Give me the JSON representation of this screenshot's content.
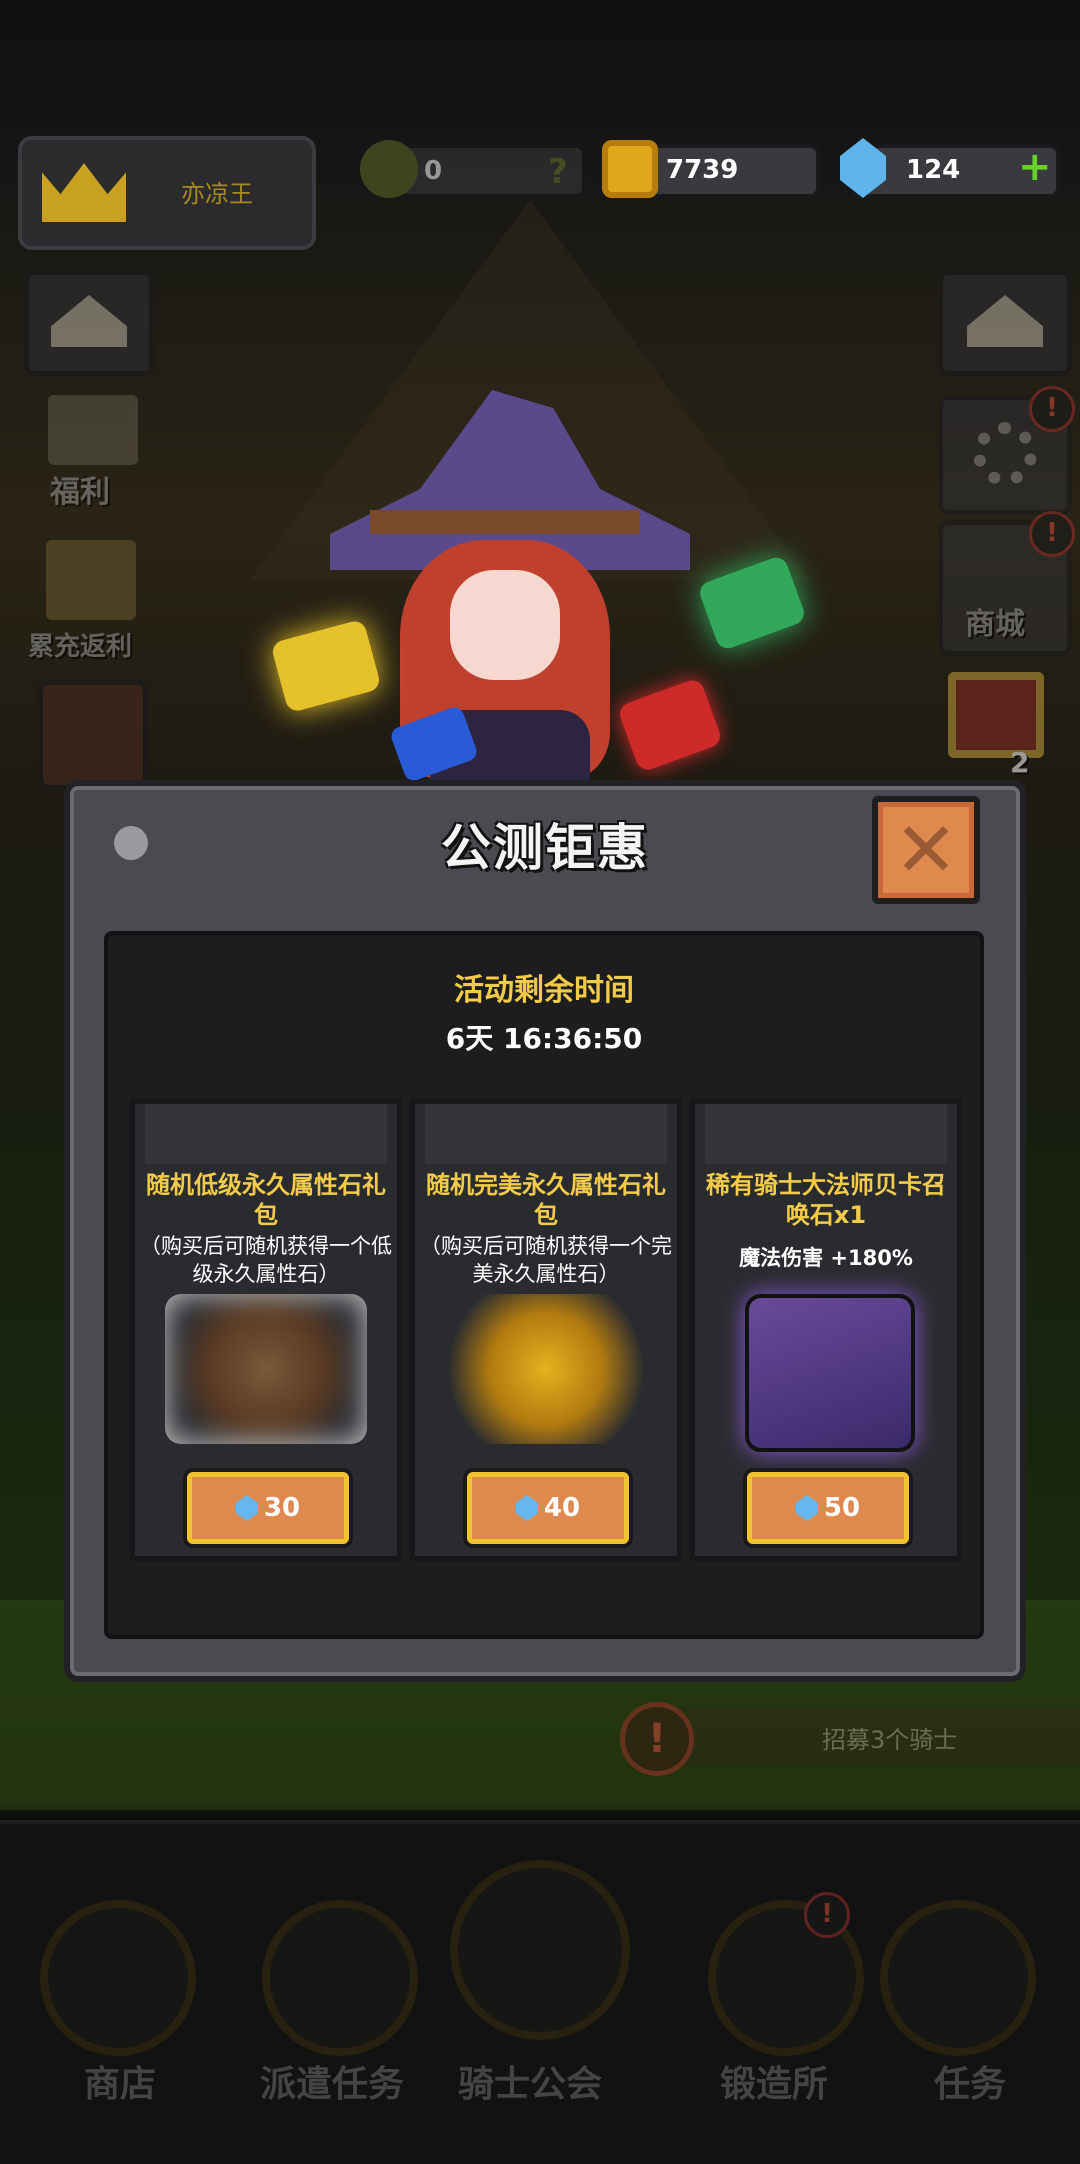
{
  "header": {
    "player_name": "亦凉王",
    "ticket_count": "0",
    "ticket_help": "?",
    "gold": "7739",
    "gems": "124",
    "add_symbol": "+"
  },
  "left_menu": [
    {
      "label": "福利"
    },
    {
      "label": "累充返利"
    }
  ],
  "right_menu": [
    {
      "label": "商城"
    },
    {
      "badge": "2"
    }
  ],
  "modal": {
    "title": "公测钜惠",
    "timer_label": "活动剩余时间",
    "timer_value": "6天 16:36:50",
    "cards": [
      {
        "title": "随机低级永久属性石礼包",
        "subtitle": "（购买后可随机获得一个低级永久属性石）",
        "price": "30"
      },
      {
        "title": "随机完美永久属性石礼包",
        "subtitle": "（购买后可随机获得一个完美永久属性石）",
        "price": "40"
      },
      {
        "title": "稀有骑士大法师贝卡召唤石x1",
        "subtitle": "魔法伤害 +180%",
        "price": "50"
      }
    ]
  },
  "quest_banner": {
    "text": "招募3个骑士"
  },
  "bottom_nav": [
    {
      "label": "商店"
    },
    {
      "label": "派遣任务"
    },
    {
      "label": "骑士公会"
    },
    {
      "label": "锻造所"
    },
    {
      "label": "任务"
    }
  ],
  "colors": {
    "accent_gold": "#f2cc49",
    "button_orange": "#e0894e",
    "gem_blue": "#67b7ef"
  }
}
